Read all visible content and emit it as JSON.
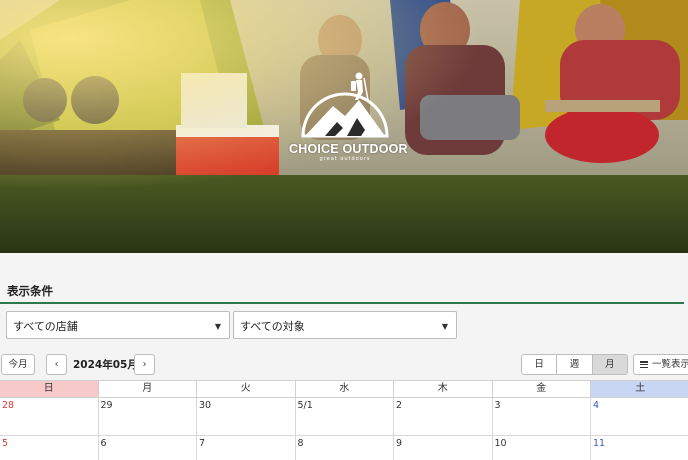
{
  "hero": {
    "brand_title": "CHOICE OUTDOOR",
    "brand_subtitle": "great outdoors"
  },
  "filters": {
    "heading": "表示条件",
    "store_select": "すべての店舗",
    "target_select": "すべての対象"
  },
  "toolbar": {
    "today_label": "今月",
    "prev_label": "‹",
    "next_label": "›",
    "month_label": "2024年05月",
    "views": [
      "日",
      "週",
      "月"
    ],
    "active_view": "月",
    "list_label": "一覧表示"
  },
  "calendar": {
    "weekdays": [
      "日",
      "月",
      "火",
      "水",
      "木",
      "金",
      "土"
    ],
    "weeks": [
      [
        "28",
        "29",
        "30",
        "5/1",
        "2",
        "3",
        "4"
      ],
      [
        "5",
        "6",
        "7",
        "8",
        "9",
        "10",
        "11"
      ]
    ]
  }
}
